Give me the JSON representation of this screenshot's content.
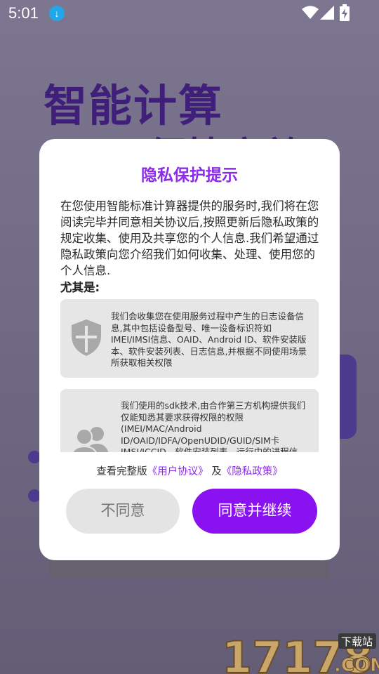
{
  "status_bar": {
    "time": "5:01",
    "download_icon": "download-icon",
    "wifi_icon": "wifi-icon",
    "signal_icon": "signal-icon",
    "battery_icon": "battery-charging-icon"
  },
  "background": {
    "title_line1": "智能计算",
    "title_line2": "便捷高效"
  },
  "dialog": {
    "title": "隐私保护提示",
    "intro": "在您使用智能标准计算器提供的服务时,我们将在您阅读完毕并同意相关协议后,按照更新后隐私政策的规定收集、使用及共享您的个人信息.我们希望通过隐私政策向您介绍我们如何收集、处理、使用您的个人信息.",
    "especially_label": "尤其是:",
    "cards": [
      {
        "icon": "shield-icon",
        "text": "我们会收集您在使用服务过程中产生的日志设备信息,其中包括设备型号、唯一设备标识符如IMEI/IMSI信息、OAID、Android ID、软件安装版本、软件安装列表、日志信息,并根据不同使用场景所获取相关权限"
      },
      {
        "icon": "users-icon",
        "text": "我们使用的sdk技术,由合作第三方机构提供我们仅能知悉其要求获得权限的权限(IMEI/MAC/Android ID/OAID/IDFA/OpenUDID/GUID/SIM卡IMSI/ICCID、软件安装列表、运行中的进程信息),其使用目的的范围方式"
      }
    ],
    "links": {
      "prefix": "查看完整版",
      "user_agreement": "《用户协议》",
      "conjunction": "及",
      "privacy_policy": "《隐私政策》"
    },
    "buttons": {
      "disagree": "不同意",
      "agree": "同意并继续"
    },
    "accent_color": "#8a12f0"
  },
  "watermark": {
    "number": "17178",
    "badge": "下载站",
    "suffix": ".COM"
  }
}
